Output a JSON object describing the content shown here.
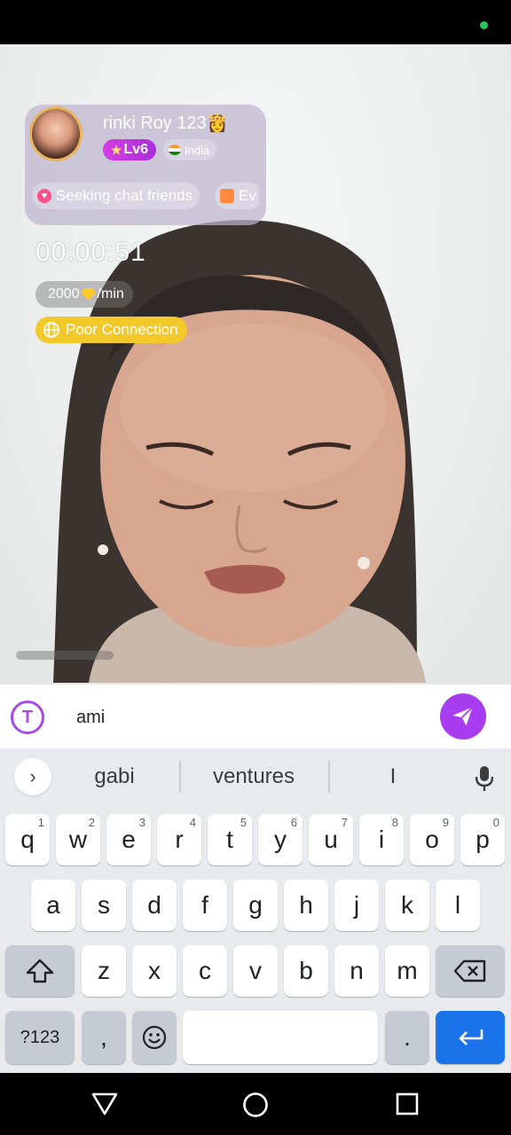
{
  "host": {
    "name": "rinki Roy 123👸",
    "level": "Lv6",
    "country": "India",
    "tags": [
      "Seeking chat friends",
      "Ev"
    ]
  },
  "call": {
    "timer": "00:00:51",
    "rate_value": "2000",
    "rate_unit": "/min",
    "connection_status": "Poor Connection"
  },
  "composer": {
    "message_text": "ami"
  },
  "keyboard": {
    "suggestions": [
      "gabi",
      "ventures",
      "I"
    ],
    "row1": [
      {
        "key": "q",
        "hint": "1"
      },
      {
        "key": "w",
        "hint": "2"
      },
      {
        "key": "e",
        "hint": "3"
      },
      {
        "key": "r",
        "hint": "4"
      },
      {
        "key": "t",
        "hint": "5"
      },
      {
        "key": "y",
        "hint": "6"
      },
      {
        "key": "u",
        "hint": "7"
      },
      {
        "key": "i",
        "hint": "8"
      },
      {
        "key": "o",
        "hint": "9"
      },
      {
        "key": "p",
        "hint": "0"
      }
    ],
    "row2": [
      "a",
      "s",
      "d",
      "f",
      "g",
      "h",
      "j",
      "k",
      "l"
    ],
    "row3": [
      "z",
      "x",
      "c",
      "v",
      "b",
      "n",
      "m"
    ],
    "symbols_label": "?123",
    "comma_label": ",",
    "period_label": "."
  },
  "colors": {
    "accent": "#a73cf0",
    "level_badge": "#d63ce6",
    "poor_connection": "#f3c92a",
    "enter_key": "#1a73e8"
  }
}
